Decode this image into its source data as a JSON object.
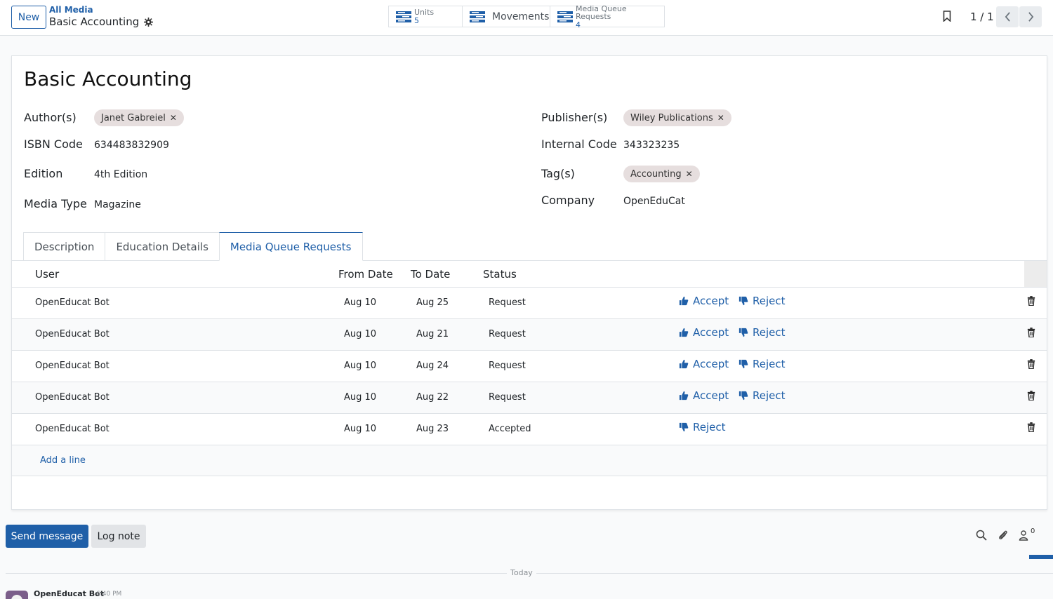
{
  "header": {
    "new_label": "New",
    "breadcrumb_parent": "All Media",
    "record_title": "Basic Accounting",
    "smart_buttons": [
      {
        "title": "Units",
        "count": "5"
      },
      {
        "title": "Movements"
      },
      {
        "title": "Media Queue Requests",
        "count": "4"
      }
    ],
    "pager": "1 / 1"
  },
  "form": {
    "title": "Basic Accounting",
    "left": {
      "authors_label": "Author(s)",
      "authors": [
        "Janet Gabreiel"
      ],
      "isbn_label": "ISBN Code",
      "isbn": "634483832909",
      "edition_label": "Edition",
      "edition": "4th Edition",
      "media_type_label": "Media Type",
      "media_type": "Magazine"
    },
    "right": {
      "publishers_label": "Publisher(s)",
      "publishers": [
        "Wiley Publications"
      ],
      "internal_code_label": "Internal Code",
      "internal_code": "343323235",
      "tags_label": "Tag(s)",
      "tags": [
        "Accounting"
      ],
      "company_label": "Company",
      "company": "OpenEduCat"
    },
    "tabs": [
      "Description",
      "Education Details",
      "Media Queue Requests"
    ],
    "table": {
      "columns": [
        "User",
        "From Date",
        "To Date",
        "Status"
      ],
      "rows": [
        {
          "user": "OpenEducat Bot",
          "from": "Aug 10",
          "to": "Aug 25",
          "status": "Request",
          "accept": "Accept",
          "reject": "Reject"
        },
        {
          "user": "OpenEducat Bot",
          "from": "Aug 10",
          "to": "Aug 21",
          "status": "Request",
          "accept": "Accept",
          "reject": "Reject"
        },
        {
          "user": "OpenEducat Bot",
          "from": "Aug 10",
          "to": "Aug 24",
          "status": "Request",
          "accept": "Accept",
          "reject": "Reject"
        },
        {
          "user": "OpenEducat Bot",
          "from": "Aug 10",
          "to": "Aug 22",
          "status": "Request",
          "accept": "Accept",
          "reject": "Reject"
        },
        {
          "user": "OpenEducat Bot",
          "from": "Aug 10",
          "to": "Aug 23",
          "status": "Accepted",
          "reject": "Reject"
        }
      ],
      "add_line": "Add a line"
    }
  },
  "chatter": {
    "send_message": "Send message",
    "log_note": "Log note",
    "followers_count": "0",
    "date_separator": "Today",
    "message_author": "OpenEducat Bot",
    "message_time": "6:40 PM"
  },
  "colors": {
    "primary": "#1f5fa8",
    "tag_bg": "#e6dede"
  }
}
